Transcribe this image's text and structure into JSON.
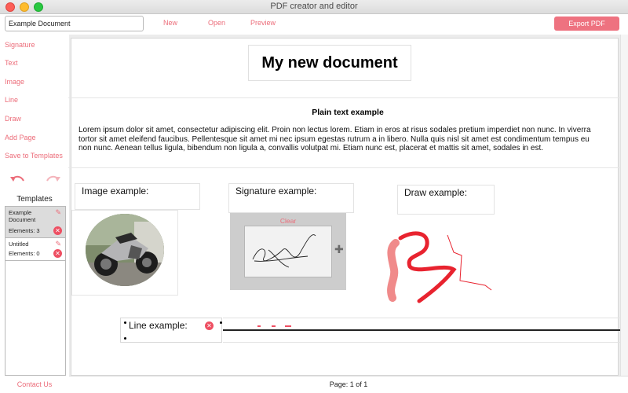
{
  "window": {
    "title": "PDF creator and editor"
  },
  "toolbar": {
    "document_name": "Example Document",
    "new_label": "New",
    "open_label": "Open",
    "preview_label": "Preview",
    "export_label": "Export PDF"
  },
  "sidebar": {
    "items": [
      "Signature",
      "Text",
      "Image",
      "Line",
      "Draw",
      "Add Page",
      "Save to Templates"
    ],
    "templates_title": "Templates",
    "templates": [
      {
        "name": "Example Document",
        "elements": "Elements: 3"
      },
      {
        "name": "Untitled",
        "elements": "Elements: 0"
      }
    ],
    "contact_label": "Contact Us"
  },
  "document": {
    "title": "My new document",
    "text_title": "Plain text example",
    "text_body": "Lorem ipsum dolor sit amet, consectetur adipiscing elit. Proin non lectus lorem. Etiam in eros at risus sodales pretium imperdiet non nunc. In viverra tortor sit amet eleifend faucibus. Pellentesque sit amet mi nec ipsum egestas rutrum a in libero. Nulla quis nisl sit amet est condimentum tempus eu non nunc. Aenean tellus ligula, bibendum non ligula a, convallis volutpat mi. Etiam nunc est, placerat et mattis sit amet, sodales in est.",
    "image_label": "Image example:",
    "signature_label": "Signature example:",
    "signature_clear": "Clear",
    "draw_label": "Draw example:",
    "line_label": "Line example:"
  },
  "status": {
    "page": "Page: 1 of 1"
  },
  "colors": {
    "accent": "#ec6d7a",
    "button": "#ee7280",
    "draw_red": "#e8232f",
    "draw_pink": "#f08a8a"
  }
}
